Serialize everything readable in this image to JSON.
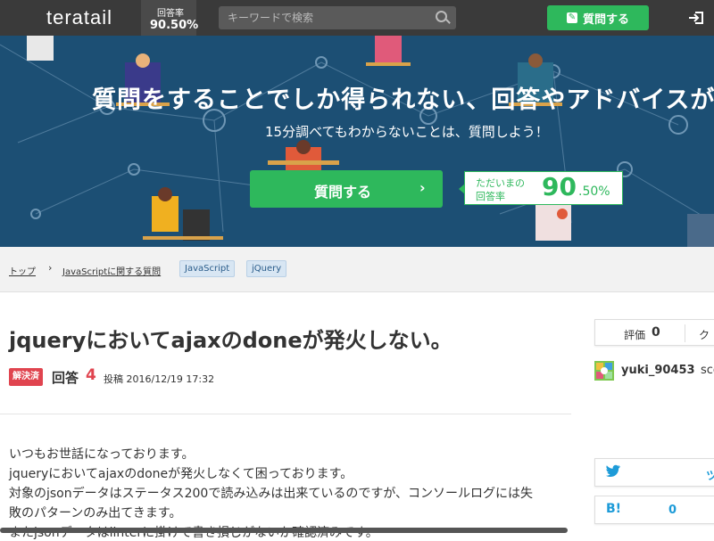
{
  "header": {
    "logo": "teratail",
    "rate_label": "回答率",
    "rate_value": "90.50%",
    "search_placeholder": "キーワードで検索",
    "ask_button": "質問する"
  },
  "hero": {
    "title": "質問をすることでしか得られない、回答やアドバイスがある。",
    "subtitle": "15分調べてもわからないことは、質問しよう！",
    "button_label": "質問する",
    "rate_line1": "ただいまの",
    "rate_line2": "回答率",
    "rate_big": "90",
    "rate_decimal": ".50%"
  },
  "breadcrumb": {
    "top": "トップ",
    "category": "JavaScriptに関する質問",
    "tags": [
      "JavaScript",
      "jQuery"
    ]
  },
  "question": {
    "title": "jqueryにおいてajaxのdoneが発火しない。",
    "solved_badge": "解決済",
    "answers_label": "回答",
    "answers_count": "4",
    "posted": "投稿 2016/12/19 17:32",
    "body": [
      "いつもお世話になっております。",
      "jqueryにおいてajaxのdoneが発火しなくて困っております。",
      "対象のjsonデータはステータス200で読み込みは出来ているのですが、コンソールログには失",
      "敗のパターンのみ出てきます。",
      "またjsonデータはlinterに掛けて書き損じがないか確認済みです。"
    ]
  },
  "sidebar": {
    "eval_label": "評価",
    "eval_value": "0",
    "clip_label": "ク",
    "username": "yuki_90453",
    "score_label": "sco",
    "twitter_icon": "twitter-icon",
    "twitter_label": "ツ",
    "hatena_label": "B!",
    "hatena_count": "0"
  },
  "colors": {
    "header_bg": "#3a3a3a",
    "hero_bg": "#1c4f74",
    "accent_green": "#2eb85c",
    "solved_red": "#e0444f",
    "tag_bg": "#d8e6f3"
  }
}
